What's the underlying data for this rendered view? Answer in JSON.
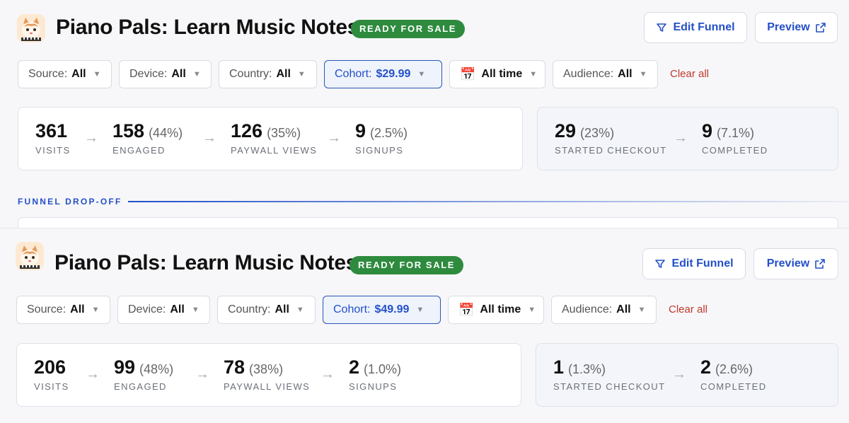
{
  "colors": {
    "accent": "#2450c8",
    "badge_green": "#2e8b3e",
    "clear_red": "#c0392b"
  },
  "panels": [
    {
      "header": {
        "title": "Piano Pals: Learn Music Notes",
        "status_badge": "READY FOR SALE",
        "edit_funnel_label": "Edit Funnel",
        "preview_label": "Preview"
      },
      "filters": {
        "source": {
          "label": "Source:",
          "value": "All"
        },
        "device": {
          "label": "Device:",
          "value": "All"
        },
        "country": {
          "label": "Country:",
          "value": "All"
        },
        "cohort": {
          "label": "Cohort:",
          "value": "$29.99"
        },
        "date": {
          "icon": "calendar-icon",
          "value": "All time"
        },
        "audience": {
          "label": "Audience:",
          "value": "All"
        },
        "clear_all": "Clear all"
      },
      "funnel": [
        {
          "value": "361",
          "pct": "",
          "label": "VISITS"
        },
        {
          "value": "158",
          "pct": "(44%)",
          "label": "ENGAGED"
        },
        {
          "value": "126",
          "pct": "(35%)",
          "label": "PAYWALL VIEWS"
        },
        {
          "value": "9",
          "pct": "(2.5%)",
          "label": "SIGNUPS"
        }
      ],
      "checkout": [
        {
          "value": "29",
          "pct": "(23%)",
          "label": "STARTED CHECKOUT"
        },
        {
          "value": "9",
          "pct": "(7.1%)",
          "label": "COMPLETED"
        }
      ],
      "section_label": "FUNNEL DROP-OFF"
    },
    {
      "header": {
        "title": "Piano Pals: Learn Music Notes",
        "status_badge": "READY FOR SALE",
        "edit_funnel_label": "Edit Funnel",
        "preview_label": "Preview"
      },
      "filters": {
        "source": {
          "label": "Source:",
          "value": "All"
        },
        "device": {
          "label": "Device:",
          "value": "All"
        },
        "country": {
          "label": "Country:",
          "value": "All"
        },
        "cohort": {
          "label": "Cohort:",
          "value": "$49.99"
        },
        "date": {
          "icon": "calendar-icon",
          "value": "All time"
        },
        "audience": {
          "label": "Audience:",
          "value": "All"
        },
        "clear_all": "Clear all"
      },
      "funnel": [
        {
          "value": "206",
          "pct": "",
          "label": "VISITS"
        },
        {
          "value": "99",
          "pct": "(48%)",
          "label": "ENGAGED"
        },
        {
          "value": "78",
          "pct": "(38%)",
          "label": "PAYWALL VIEWS"
        },
        {
          "value": "2",
          "pct": "(1.0%)",
          "label": "SIGNUPS"
        }
      ],
      "checkout": [
        {
          "value": "1",
          "pct": "(1.3%)",
          "label": "STARTED CHECKOUT"
        },
        {
          "value": "2",
          "pct": "(2.6%)",
          "label": "COMPLETED"
        }
      ]
    }
  ]
}
